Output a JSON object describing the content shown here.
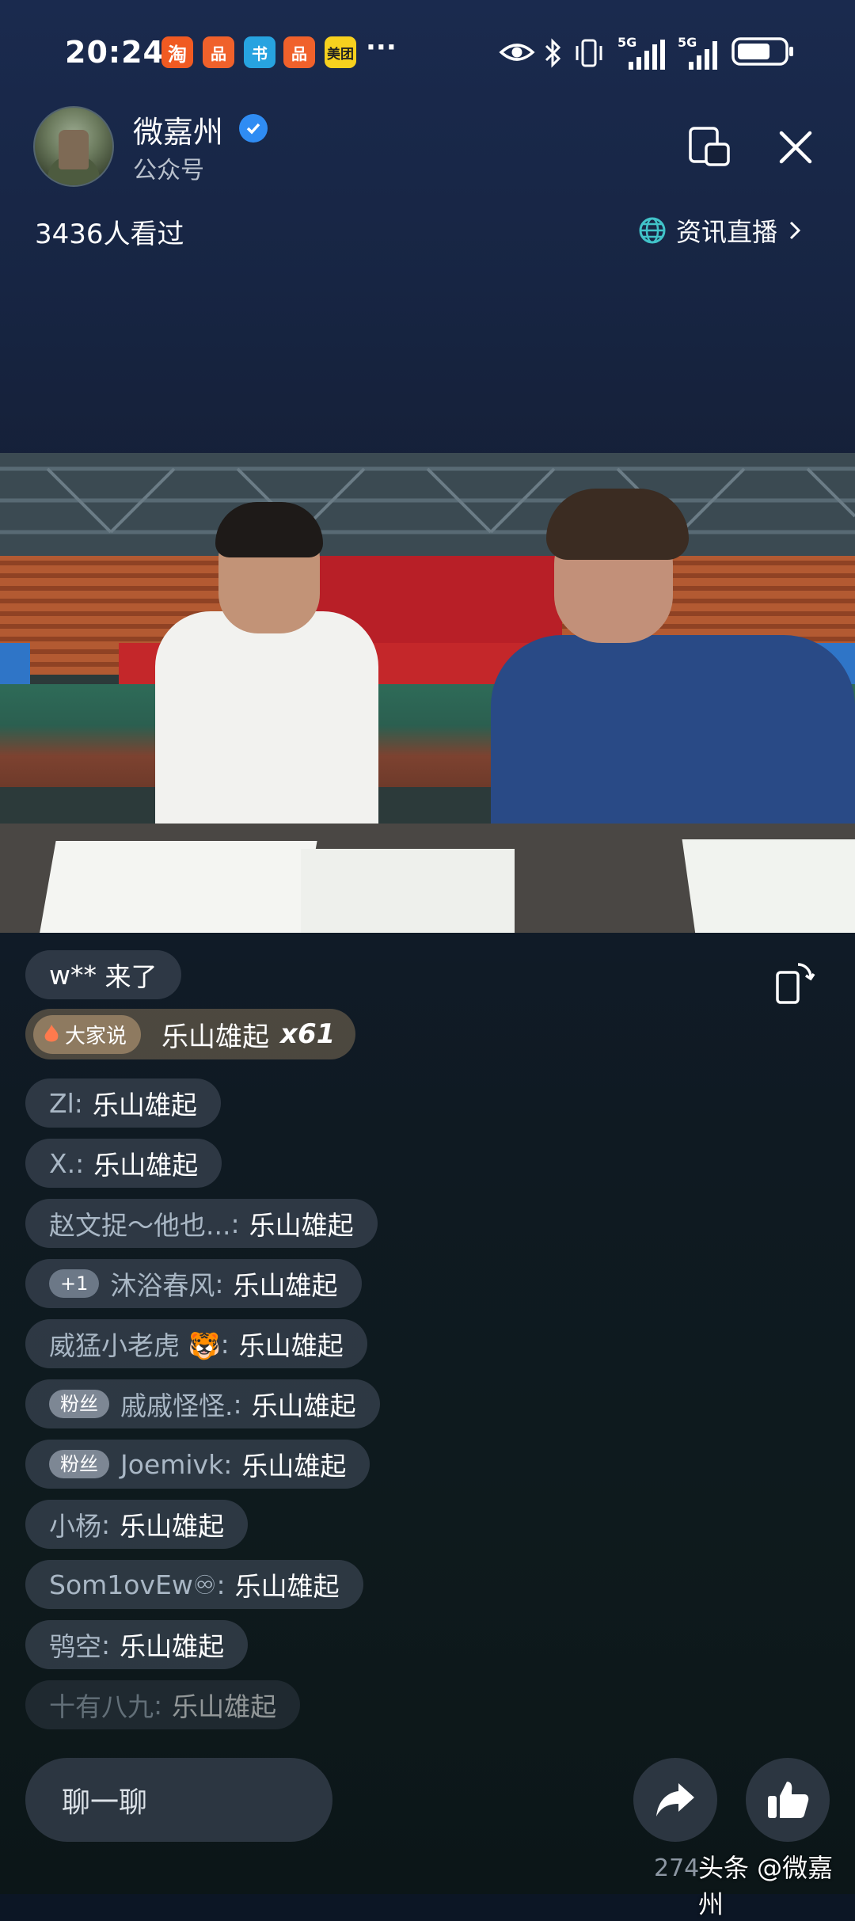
{
  "status_bar": {
    "time": "20:24",
    "apps": [
      "淘",
      "品",
      "书",
      "品",
      "美团"
    ],
    "more": "···",
    "network1": "5G",
    "network2": "5G"
  },
  "header": {
    "account_name": "微嘉州",
    "account_type": "公众号",
    "view_count": "3436人看过",
    "channel_link": "资讯直播"
  },
  "chat": {
    "entrance": {
      "user": "w**",
      "text": "来了"
    },
    "everyone_says": {
      "tag": "大家说",
      "text": "乐山雄起",
      "count": "x61"
    },
    "messages": [
      {
        "badge": "",
        "user": "Zl",
        "sep": ":",
        "text": "乐山雄起"
      },
      {
        "badge": "",
        "user": "X.",
        "sep": ":",
        "text": "乐山雄起"
      },
      {
        "badge": "",
        "user": "赵文捉～他也...",
        "sep": ":",
        "text": "乐山雄起"
      },
      {
        "badge": "+1",
        "user": "沐浴春风",
        "sep": ":",
        "text": "乐山雄起"
      },
      {
        "badge": "",
        "user": "威猛小老虎 🐯",
        "sep": ":",
        "text": "乐山雄起"
      },
      {
        "badge": "粉丝",
        "user": "戚戚怪怪.",
        "sep": ":",
        "text": "乐山雄起"
      },
      {
        "badge": "粉丝",
        "user": "Joemivk",
        "sep": ":",
        "text": "乐山雄起"
      },
      {
        "badge": "",
        "user": "小杨",
        "sep": ":",
        "text": "乐山雄起"
      },
      {
        "badge": "",
        "user": "Som1ovEw♾",
        "sep": ":",
        "text": "乐山雄起"
      },
      {
        "badge": "",
        "user": "鸮空",
        "sep": ":",
        "text": "乐山雄起"
      },
      {
        "badge": "",
        "user": "十有八九",
        "sep": ":",
        "text": "乐山雄起"
      }
    ]
  },
  "bottom": {
    "chat_placeholder": "聊一聊",
    "like_count": "274",
    "watermark": "头条 @微嘉州"
  },
  "colors": {
    "verified": "#2f8cf3",
    "bubble": "#3a4452"
  }
}
